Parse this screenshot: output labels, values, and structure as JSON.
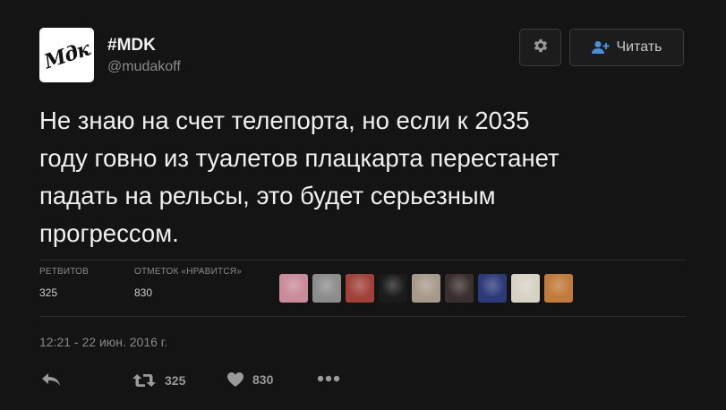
{
  "account": {
    "avatar_text": "Мдк",
    "display_name": "#MDK",
    "screen_name": "@mudakoff"
  },
  "header": {
    "settings_icon": "gear-icon",
    "follow_label": "Читать",
    "follow_icon": "add-user-icon"
  },
  "tweet": {
    "lines": [
      "Не знаю на счет телепорта, но если к 2035",
      "году говно из туалетов плацкарта перестанет",
      "падать на рельсы, это будет серьезным",
      "прогрессом."
    ]
  },
  "stats": {
    "retweets_label": "РЕТВИТОВ",
    "retweets_value": "325",
    "likes_label": "ОТМЕТОК «НРАВИТСЯ»",
    "likes_value": "830"
  },
  "likers": [
    {
      "name": "liker-1",
      "color": "#c98a9a"
    },
    {
      "name": "liker-2",
      "color": "#8c8c8c"
    },
    {
      "name": "liker-3",
      "color": "#a0423a"
    },
    {
      "name": "liker-4",
      "color": "#1b1b1b"
    },
    {
      "name": "liker-5",
      "color": "#a89a8a"
    },
    {
      "name": "liker-6",
      "color": "#3a2e2e"
    },
    {
      "name": "liker-7",
      "color": "#2d3a7a"
    },
    {
      "name": "liker-8",
      "color": "#d8d2c4"
    },
    {
      "name": "liker-9",
      "color": "#c07a3a"
    }
  ],
  "timestamp": "12:21 - 22 июн. 2016 г.",
  "actions": {
    "reply_icon": "reply-icon",
    "retweet_icon": "retweet-icon",
    "retweet_count": "325",
    "like_icon": "heart-icon",
    "like_count": "830",
    "more_icon": "more-icon"
  },
  "colors": {
    "background": "#141414",
    "text": "#f0f0f0",
    "muted": "#8a8a8a",
    "accent": "#4a90d9"
  }
}
